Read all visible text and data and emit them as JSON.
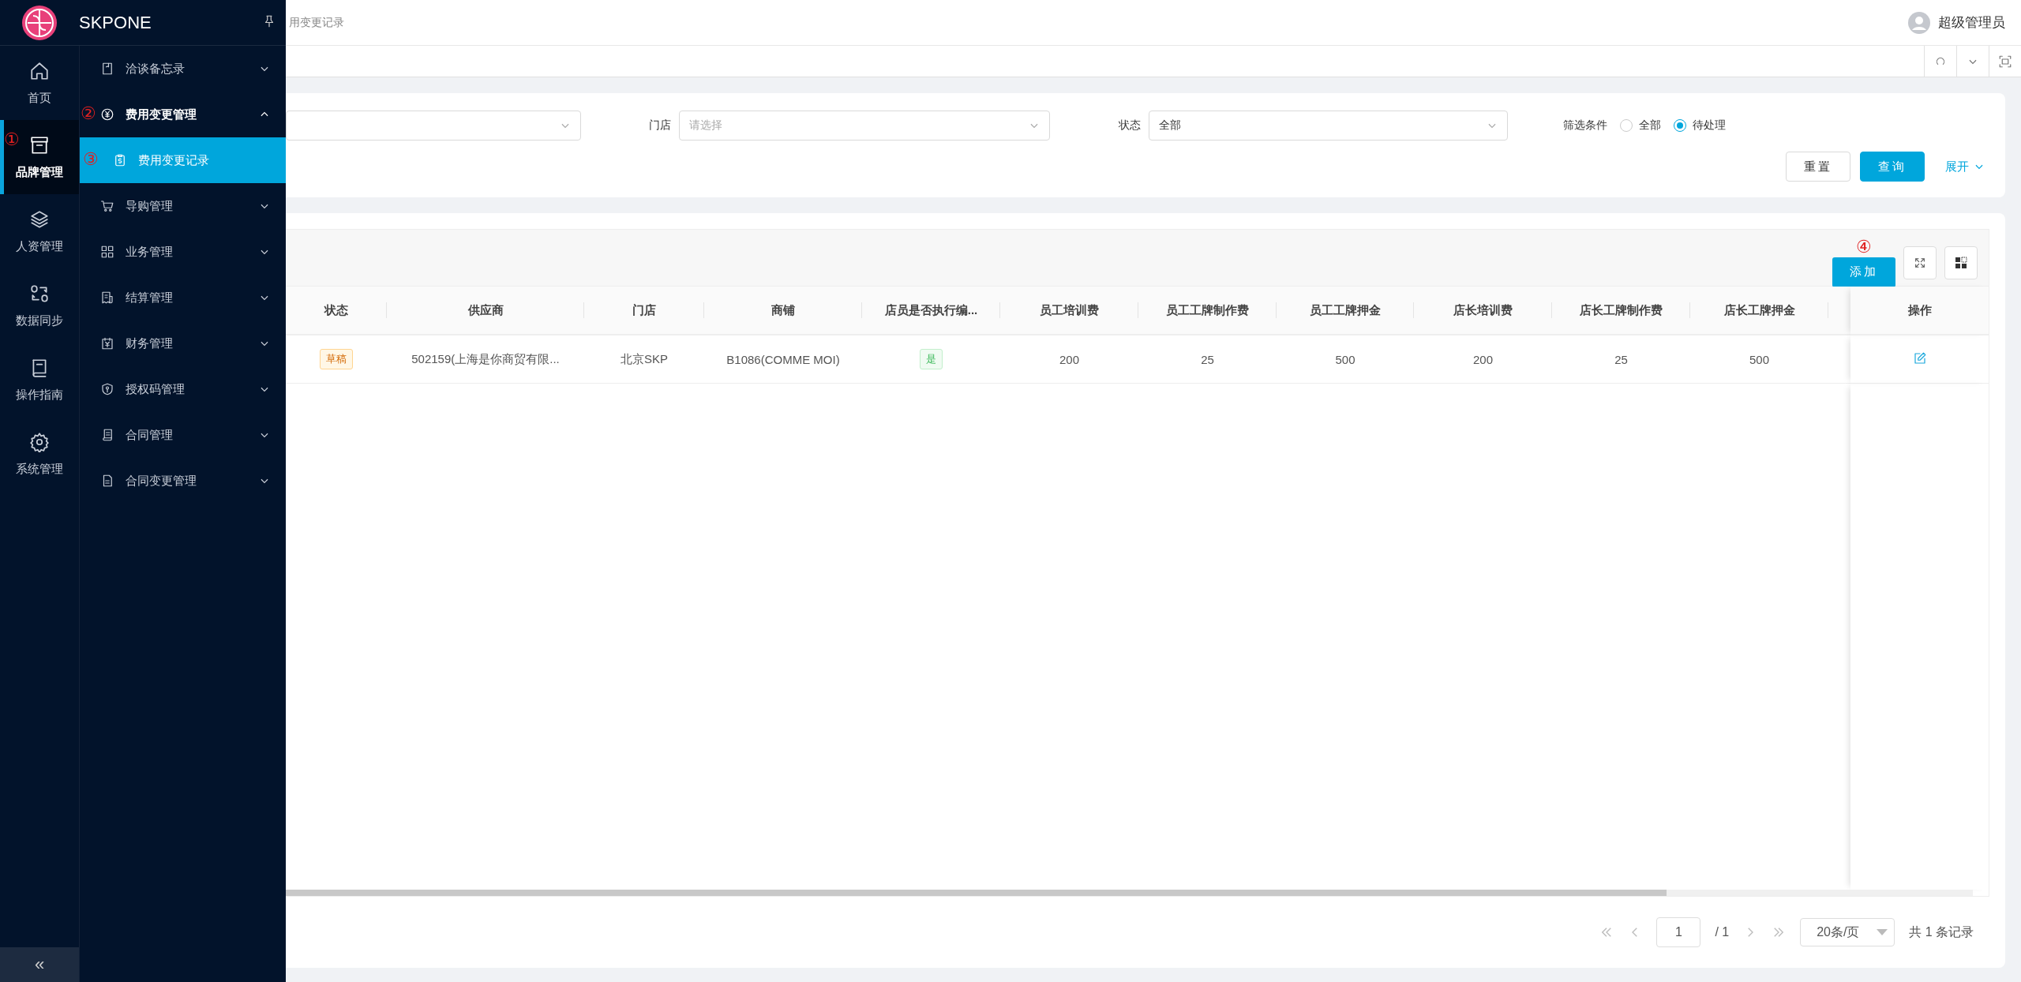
{
  "sidebar": {
    "brand": "SKPONE",
    "rail": [
      {
        "label": "首页",
        "selected": false
      },
      {
        "label": "品牌管理",
        "selected": true,
        "callout": "①"
      },
      {
        "label": "人资管理",
        "selected": false
      },
      {
        "label": "数据同步",
        "selected": false
      },
      {
        "label": "操作指南",
        "selected": false
      },
      {
        "label": "系统管理",
        "selected": false
      }
    ],
    "collapse": "«",
    "menu": [
      {
        "label": "洽谈备忘录",
        "expanded": false
      },
      {
        "label": "费用变更管理",
        "expanded": true,
        "callout": "②",
        "children": [
          {
            "label": "费用变更记录",
            "selected": true,
            "callout": "③"
          }
        ]
      },
      {
        "label": "导购管理",
        "expanded": false
      },
      {
        "label": "业务管理",
        "expanded": false
      },
      {
        "label": "结算管理",
        "expanded": false
      },
      {
        "label": "财务管理",
        "expanded": false
      },
      {
        "label": "授权码管理",
        "expanded": false
      },
      {
        "label": "合同管理",
        "expanded": false
      },
      {
        "label": "合同变更管理",
        "expanded": false
      }
    ]
  },
  "header": {
    "breadcrumb": "用变更记录",
    "user": "超级管理员"
  },
  "filters": {
    "fields": [
      {
        "kind": "select"
      },
      {
        "kind": "select",
        "label": "门店",
        "placeholder": "请选择"
      },
      {
        "kind": "select",
        "label": "状态",
        "value": "全部"
      }
    ],
    "radio_group": {
      "label": "筛选条件",
      "options": [
        {
          "label": "全部",
          "selected": false
        },
        {
          "label": "待处理",
          "selected": true
        }
      ]
    },
    "reset": "重置",
    "query": "查询",
    "expand": "展开"
  },
  "table": {
    "add": "添加",
    "add_callout": "④",
    "columns": [
      "状态",
      "供应商",
      "门店",
      "商铺",
      "店员是否执行编...",
      "员工培训费",
      "员工工牌制作费",
      "员工工牌押金",
      "店长培训费",
      "店长工牌制作费",
      "店长工牌押金"
    ],
    "action_column": "操作",
    "rows": [
      {
        "cells": [
          {
            "kind": "warning",
            "text": "草稿"
          },
          {
            "kind": "text",
            "text": "502159(上海是你商贸有限..."
          },
          {
            "kind": "text",
            "text": "北京SKP"
          },
          {
            "kind": "text",
            "text": "B1086(COMME MOI)"
          },
          {
            "kind": "success",
            "text": "是"
          },
          {
            "kind": "text",
            "text": "200"
          },
          {
            "kind": "text",
            "text": "25"
          },
          {
            "kind": "text",
            "text": "500"
          },
          {
            "kind": "text",
            "text": "200"
          },
          {
            "kind": "text",
            "text": "25"
          },
          {
            "kind": "text",
            "text": "500"
          }
        ]
      }
    ]
  },
  "pagination": {
    "page": "1",
    "pages": "/ 1",
    "page_size": "20条/页",
    "total": "共 1 条记录"
  }
}
